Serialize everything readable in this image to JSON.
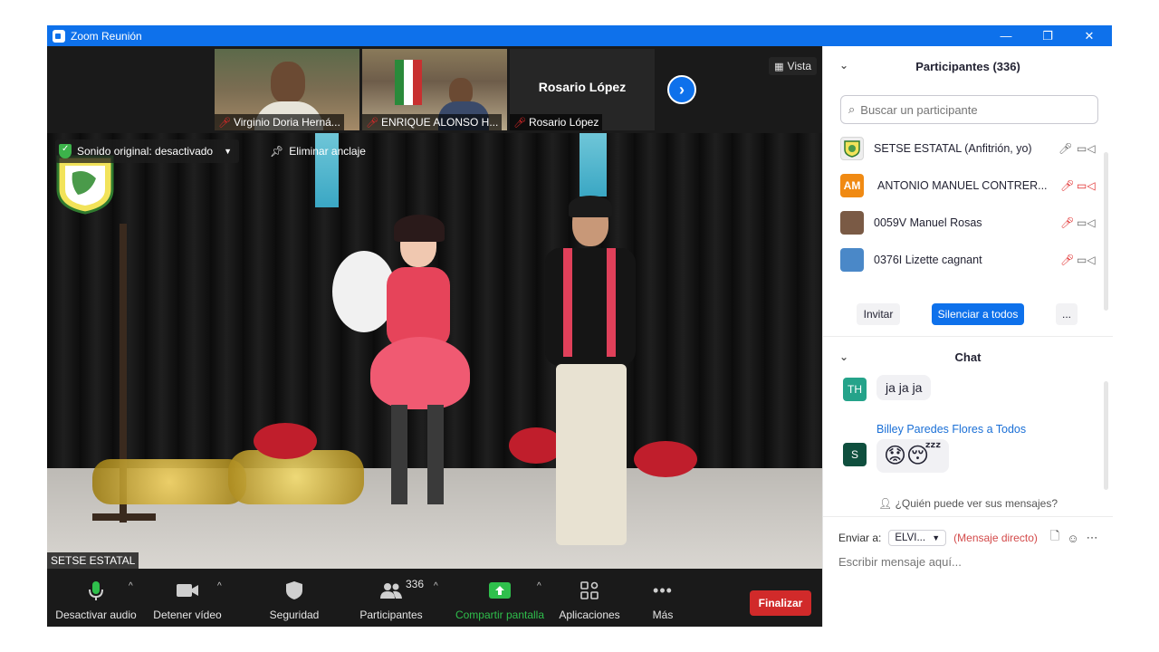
{
  "window": {
    "title": "Zoom Reunión",
    "minimize_glyph": "—",
    "restore_glyph": "❐",
    "close_glyph": "✕"
  },
  "top_strip": {
    "thumbnails": [
      {
        "name": "Virginio Doria Herná..."
      },
      {
        "name": "ENRIQUE ALONSO H..."
      },
      {
        "name": "Rosario López",
        "big_name": "Rosario López"
      }
    ],
    "view_label": "Vista"
  },
  "main_video": {
    "audio_status": "Sonido original: desactivado",
    "unpin_label": "Eliminar anclaje",
    "speaker_name": "SETSE ESTATAL"
  },
  "toolbar": {
    "mute_label": "Desactivar audio",
    "video_label": "Detener vídeo",
    "security_label": "Seguridad",
    "participants_label": "Participantes",
    "participants_count": "336",
    "share_label": "Compartir pantalla",
    "apps_label": "Aplicaciones",
    "more_label": "Más",
    "end_label": "Finalizar"
  },
  "participants_panel": {
    "title": "Participantes (336)",
    "search_placeholder": "Buscar un participante",
    "participants": [
      {
        "name": "SETSE ESTATAL (Anfitrión, yo)",
        "avatar_color": "#e8e8e8",
        "mic": "on",
        "video": "on"
      },
      {
        "name": "ANTONIO MANUEL CONTRER...",
        "initials": "AM",
        "avatar_color": "#f08a13",
        "mic": "off",
        "video": "off"
      },
      {
        "name": "0059V Manuel Rosas",
        "avatar_color": "#7a5a45",
        "mic": "off",
        "video": "on"
      },
      {
        "name": "0376I Lizette cagnant",
        "avatar_color": "#4a88c8",
        "mic": "off",
        "video": "on"
      }
    ],
    "invite_label": "Invitar",
    "mute_all_label": "Silenciar a todos",
    "more_label": "..."
  },
  "chat": {
    "title": "Chat",
    "messages": [
      {
        "avatar": "TH",
        "avatar_color": "#25a38a",
        "text": "ja ja ja"
      },
      {
        "avatar": "S",
        "avatar_color": "#0f4f3e",
        "sender": "Billey Paredes Flores a Todos",
        "text": "😟😴"
      }
    ],
    "who_sees": "¿Quién puede ver sus mensajes?",
    "send_to_label": "Enviar a:",
    "recipient": "ELVI...",
    "direct_label": "(Mensaje directo)",
    "compose_placeholder": "Escribir mensaje aquí..."
  }
}
